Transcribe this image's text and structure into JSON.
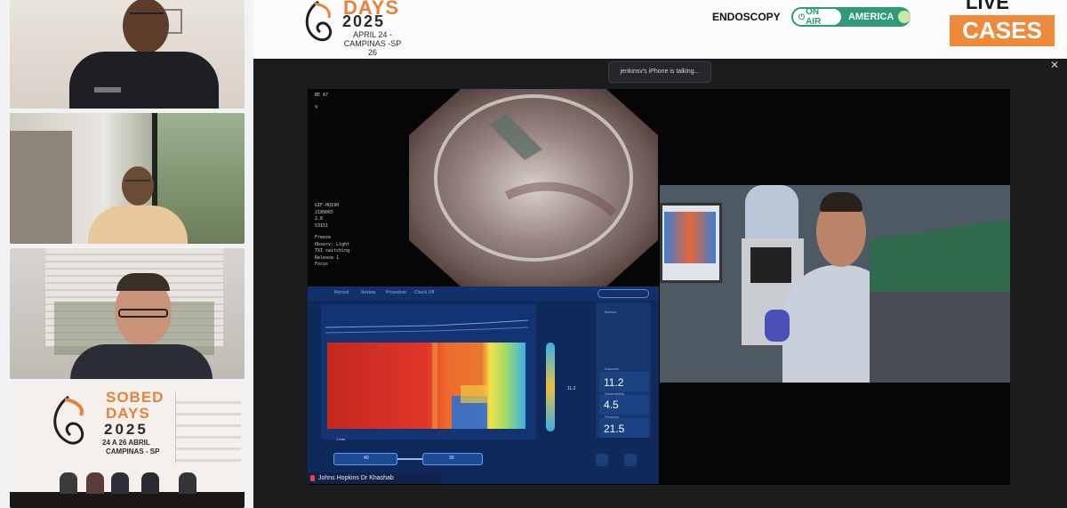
{
  "banner": {
    "event_name": "DAYS",
    "event_year": "2025",
    "event_date_line1": "APRIL 24 -",
    "event_date_line2": "CAMPINAS -SP",
    "event_date_line3": "26",
    "program_name": "ENDOSCOPY",
    "on_air_label": "ON AIR",
    "region_label": "AMERICA",
    "live_label": "LIVE",
    "cases_label": "CASES"
  },
  "screen_share": {
    "talking_indicator": "jenkinsv's iPhone is talking...",
    "presenter_label": "Johns Hopkins Dr Khashab",
    "scope_info": [
      "GIF-HQ190",
      "2189065",
      "2.8",
      "53151"
    ],
    "scope_modes": [
      "Freeze",
      "Observ. Light",
      "TXI switching",
      "Release 1",
      "Focus"
    ],
    "top_info": [
      "BE A7",
      "Ч"
    ],
    "manometry": {
      "toolbar": [
        "Record",
        "Review",
        "Procedure",
        "Check Off"
      ],
      "catheter_value_1": "40",
      "catheter_value_2": "30",
      "stats": [
        {
          "label": "Balloon",
          "value": ""
        },
        {
          "label": "Diameter",
          "value": "11.2"
        },
        {
          "label": "Distensibility",
          "value": "4.5"
        },
        {
          "label": "Pressure",
          "value": "21.5"
        }
      ],
      "mid_value": "11.2",
      "speed_label": "1 mm"
    }
  },
  "participants": [
    {
      "name": "participant-1"
    },
    {
      "name": "participant-2"
    },
    {
      "name": "participant-3"
    },
    {
      "name": "panel-stage"
    }
  ],
  "stage": {
    "title_line1": "SOBED",
    "title_line2": "DAYS",
    "title_year": "2025",
    "title_date": "24 A 26 ABRIL",
    "title_city": "CAMPINAS - SP"
  },
  "colors": {
    "accent_orange": "#ee8a3c",
    "on_air_green": "#2f9a7a"
  }
}
